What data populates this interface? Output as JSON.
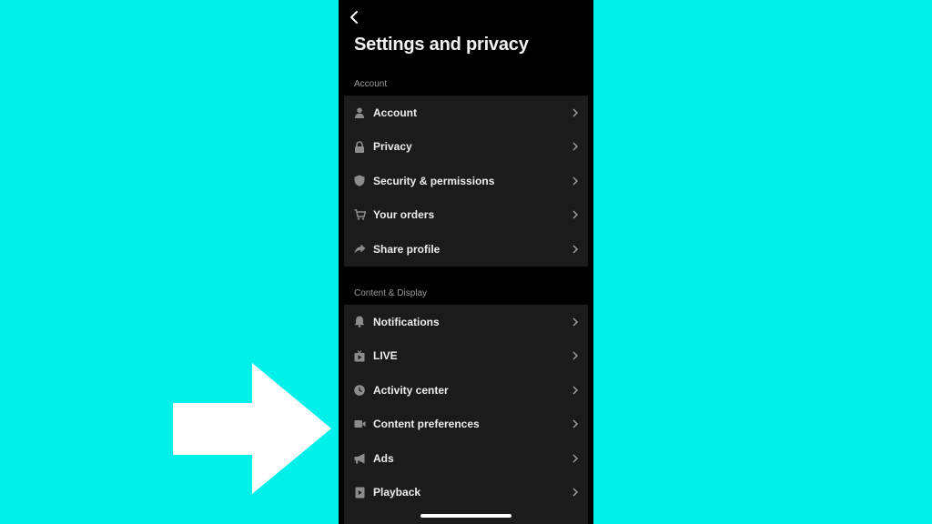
{
  "header": {
    "title": "Settings and privacy",
    "back_icon": "chevron-left-icon"
  },
  "sections": [
    {
      "label": "Account",
      "items": [
        {
          "label": "Account",
          "icon": "person-icon"
        },
        {
          "label": "Privacy",
          "icon": "lock-icon"
        },
        {
          "label": "Security & permissions",
          "icon": "shield-icon"
        },
        {
          "label": "Your orders",
          "icon": "cart-icon"
        },
        {
          "label": "Share profile",
          "icon": "share-icon"
        }
      ]
    },
    {
      "label": "Content & Display",
      "items": [
        {
          "label": "Notifications",
          "icon": "bell-icon"
        },
        {
          "label": "LIVE",
          "icon": "tv-icon"
        },
        {
          "label": "Activity center",
          "icon": "clock-icon"
        },
        {
          "label": "Content preferences",
          "icon": "video-camera-icon"
        },
        {
          "label": "Ads",
          "icon": "megaphone-icon"
        },
        {
          "label": "Playback",
          "icon": "play-icon"
        }
      ]
    }
  ],
  "colors": {
    "background": "#00f0ea",
    "phone": "#000000",
    "card": "#1b1b1b",
    "arrow": "#ffffff"
  }
}
